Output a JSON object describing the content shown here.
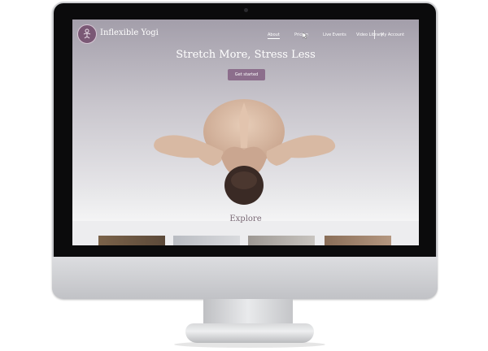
{
  "site": {
    "brand": "Inflexible Yogi",
    "logo_icon": "lotus-figure-icon"
  },
  "nav": {
    "items": [
      {
        "label": "About",
        "active": true
      },
      {
        "label": "Pricing",
        "active": false
      },
      {
        "label": "Live Events",
        "active": false
      },
      {
        "label": "Video Library",
        "active": false
      },
      {
        "label": "My Account",
        "active": false
      }
    ]
  },
  "hero": {
    "headline": "Stretch More, Stress Less",
    "cta_label": "Get started"
  },
  "explore": {
    "heading": "Explore"
  },
  "colors": {
    "accent": "#8c6e8c",
    "logo_bg": "#7a5875",
    "heading_color": "#7a6a76"
  }
}
